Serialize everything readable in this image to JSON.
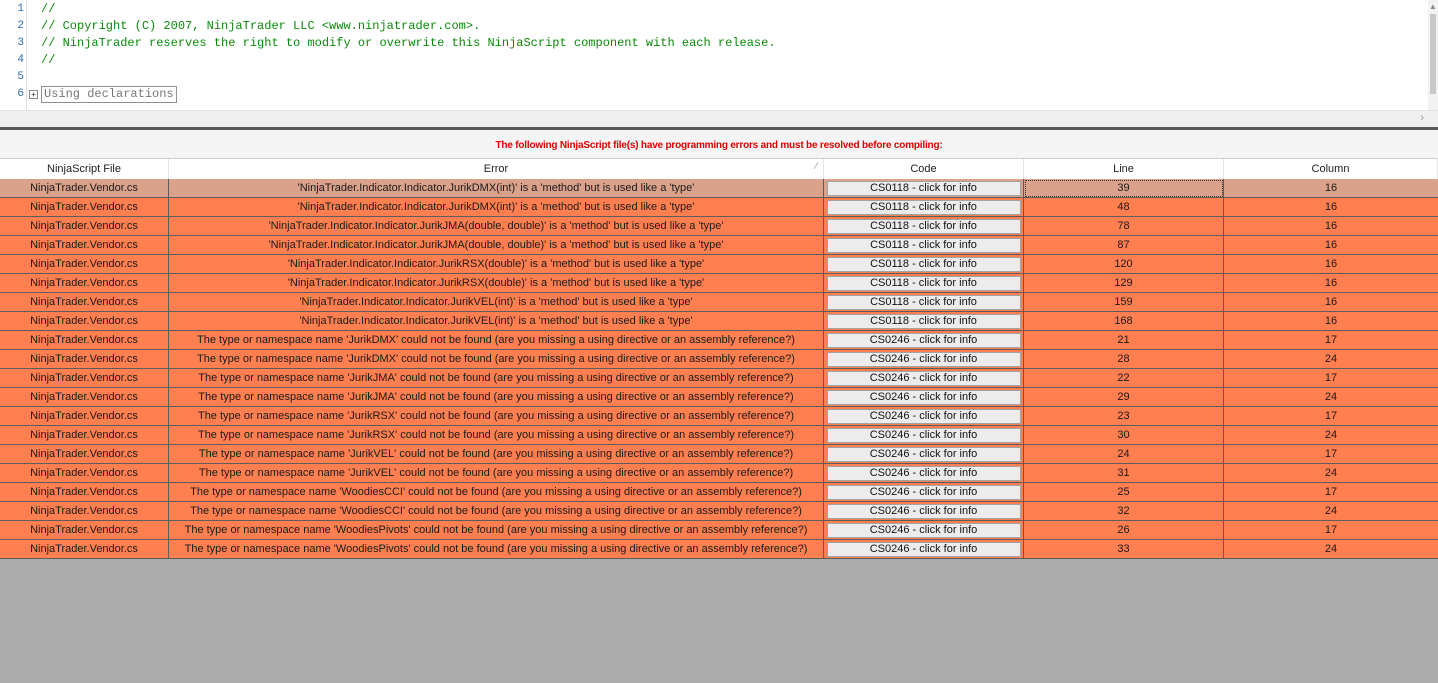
{
  "editor": {
    "line_numbers": [
      "1",
      "2",
      "3",
      "4",
      "5",
      "6"
    ],
    "lines": [
      "//",
      "// Copyright (C) 2007, NinjaTrader LLC <www.ninjatrader.com>.",
      "// NinjaTrader reserves the right to modify or overwrite this NinjaScript component with each release.",
      "//",
      "",
      ""
    ],
    "fold_symbol": "+",
    "region_label": "Using declarations"
  },
  "panel": {
    "banner": "The following NinjaScript file(s) have programming errors and must be resolved before compiling:",
    "columns": [
      "NinjaScript File",
      "Error",
      "Code",
      "Line",
      "Column"
    ]
  },
  "errors": [
    {
      "file": "NinjaTrader.Vendor.cs",
      "error": "'NinjaTrader.Indicator.Indicator.JurikDMX(int)' is a 'method' but is used like a 'type'",
      "code": "CS0118 - click for info",
      "line": "39",
      "column": "16"
    },
    {
      "file": "NinjaTrader.Vendor.cs",
      "error": "'NinjaTrader.Indicator.Indicator.JurikDMX(int)' is a 'method' but is used like a 'type'",
      "code": "CS0118 - click for info",
      "line": "48",
      "column": "16"
    },
    {
      "file": "NinjaTrader.Vendor.cs",
      "error": "'NinjaTrader.Indicator.Indicator.JurikJMA(double, double)' is a 'method' but is used like a 'type'",
      "code": "CS0118 - click for info",
      "line": "78",
      "column": "16"
    },
    {
      "file": "NinjaTrader.Vendor.cs",
      "error": "'NinjaTrader.Indicator.Indicator.JurikJMA(double, double)' is a 'method' but is used like a 'type'",
      "code": "CS0118 - click for info",
      "line": "87",
      "column": "16"
    },
    {
      "file": "NinjaTrader.Vendor.cs",
      "error": "'NinjaTrader.Indicator.Indicator.JurikRSX(double)' is a 'method' but is used like a 'type'",
      "code": "CS0118 - click for info",
      "line": "120",
      "column": "16"
    },
    {
      "file": "NinjaTrader.Vendor.cs",
      "error": "'NinjaTrader.Indicator.Indicator.JurikRSX(double)' is a 'method' but is used like a 'type'",
      "code": "CS0118 - click for info",
      "line": "129",
      "column": "16"
    },
    {
      "file": "NinjaTrader.Vendor.cs",
      "error": "'NinjaTrader.Indicator.Indicator.JurikVEL(int)' is a 'method' but is used like a 'type'",
      "code": "CS0118 - click for info",
      "line": "159",
      "column": "16"
    },
    {
      "file": "NinjaTrader.Vendor.cs",
      "error": "'NinjaTrader.Indicator.Indicator.JurikVEL(int)' is a 'method' but is used like a 'type'",
      "code": "CS0118 - click for info",
      "line": "168",
      "column": "16"
    },
    {
      "file": "NinjaTrader.Vendor.cs",
      "error": "The type or namespace name 'JurikDMX' could not be found (are you missing a using directive or an assembly reference?)",
      "code": "CS0246 - click for info",
      "line": "21",
      "column": "17"
    },
    {
      "file": "NinjaTrader.Vendor.cs",
      "error": "The type or namespace name 'JurikDMX' could not be found (are you missing a using directive or an assembly reference?)",
      "code": "CS0246 - click for info",
      "line": "28",
      "column": "24"
    },
    {
      "file": "NinjaTrader.Vendor.cs",
      "error": "The type or namespace name 'JurikJMA' could not be found (are you missing a using directive or an assembly reference?)",
      "code": "CS0246 - click for info",
      "line": "22",
      "column": "17"
    },
    {
      "file": "NinjaTrader.Vendor.cs",
      "error": "The type or namespace name 'JurikJMA' could not be found (are you missing a using directive or an assembly reference?)",
      "code": "CS0246 - click for info",
      "line": "29",
      "column": "24"
    },
    {
      "file": "NinjaTrader.Vendor.cs",
      "error": "The type or namespace name 'JurikRSX' could not be found (are you missing a using directive or an assembly reference?)",
      "code": "CS0246 - click for info",
      "line": "23",
      "column": "17"
    },
    {
      "file": "NinjaTrader.Vendor.cs",
      "error": "The type or namespace name 'JurikRSX' could not be found (are you missing a using directive or an assembly reference?)",
      "code": "CS0246 - click for info",
      "line": "30",
      "column": "24"
    },
    {
      "file": "NinjaTrader.Vendor.cs",
      "error": "The type or namespace name 'JurikVEL' could not be found (are you missing a using directive or an assembly reference?)",
      "code": "CS0246 - click for info",
      "line": "24",
      "column": "17"
    },
    {
      "file": "NinjaTrader.Vendor.cs",
      "error": "The type or namespace name 'JurikVEL' could not be found (are you missing a using directive or an assembly reference?)",
      "code": "CS0246 - click for info",
      "line": "31",
      "column": "24"
    },
    {
      "file": "NinjaTrader.Vendor.cs",
      "error": "The type or namespace name 'WoodiesCCI' could not be found (are you missing a using directive or an assembly reference?)",
      "code": "CS0246 - click for info",
      "line": "25",
      "column": "17"
    },
    {
      "file": "NinjaTrader.Vendor.cs",
      "error": "The type or namespace name 'WoodiesCCI' could not be found (are you missing a using directive or an assembly reference?)",
      "code": "CS0246 - click for info",
      "line": "32",
      "column": "24"
    },
    {
      "file": "NinjaTrader.Vendor.cs",
      "error": "The type or namespace name 'WoodiesPivots' could not be found (are you missing a using directive or an assembly reference?)",
      "code": "CS0246 - click for info",
      "line": "26",
      "column": "17"
    },
    {
      "file": "NinjaTrader.Vendor.cs",
      "error": "The type or namespace name 'WoodiesPivots' could not be found (are you missing a using directive or an assembly reference?)",
      "code": "CS0246 - click for info",
      "line": "33",
      "column": "24"
    }
  ],
  "colors": {
    "error_row": "#ff7f50",
    "selected_row": "#dba28b",
    "banner_text": "#dd0000",
    "comment_text": "#0a8a0a"
  }
}
